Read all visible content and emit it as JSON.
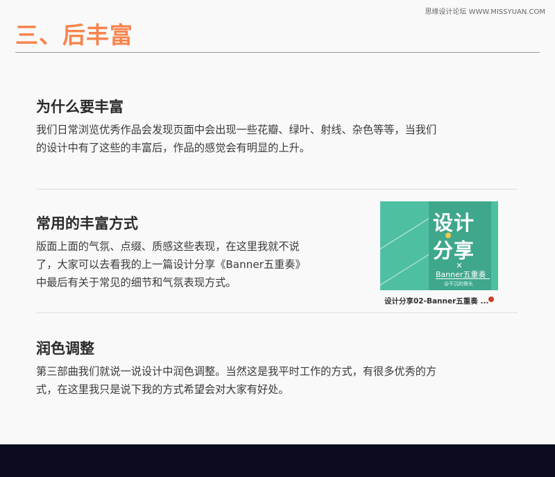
{
  "watermark": "思缘设计论坛 WWW.MISSYUAN.COM",
  "page_title": "三、后丰富",
  "sections": [
    {
      "heading": "为什么要丰富",
      "lines": [
        "我们日常浏览优秀作品会发现页面中会出现一些花瓣、绿叶、射线、杂色等等，当我们",
        "的设计中有了这些的丰富后，作品的感觉会有明显的上升。"
      ]
    },
    {
      "heading": "常用的丰富方式",
      "lines": [
        "版面上面的气氛、点缀、质感这些表现，在这里我就不说",
        "了，大家可以去看我的上一篇设计分享《Banner五重奏》",
        "中最后有关于常见的细节和气氛表现方式。"
      ]
    },
    {
      "heading": "润色调整",
      "lines": [
        "第三部曲我们就说一说设计中润色调整。当然这是我平时工作的方式，有很多优秀的方",
        "式，在这里我只是说下我的方式希望会对大家有好处。"
      ]
    }
  ],
  "thumbnail": {
    "line1": "设计",
    "line2": "分享",
    "x_mark": "×",
    "subtitle": "Banner五重奏",
    "small": "@不沉的骨头",
    "caption": "设计分享02-Banner五重奏 ..."
  },
  "colors": {
    "accent": "#f7844c",
    "thumb_bg": "#4fbfa2"
  }
}
